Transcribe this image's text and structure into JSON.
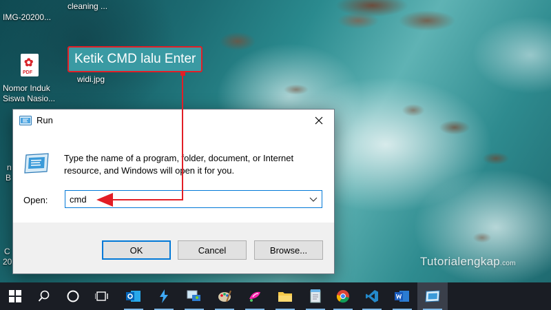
{
  "desktop": {
    "icons": [
      {
        "label": "IMG-20200..."
      },
      {
        "label": "cleaning ..."
      },
      {
        "label": "Nomor Induk Siswa Nasio..."
      },
      {
        "label": "widi.jpg"
      },
      {
        "label": "n"
      },
      {
        "label": "B"
      },
      {
        "label": "C"
      },
      {
        "label": "20"
      }
    ],
    "pdf_badge": "PDF"
  },
  "annotation": {
    "callout_text": "Ketik CMD lalu Enter",
    "color": "#e21e26"
  },
  "run_dialog": {
    "title": "Run",
    "description": "Type the name of a program, folder, document, or Internet resource, and Windows will open it for you.",
    "open_label": "Open:",
    "open_value": "cmd",
    "buttons": {
      "ok": "OK",
      "cancel": "Cancel",
      "browse": "Browse..."
    }
  },
  "watermark": {
    "text": "Tutorialengkap",
    "suffix": ".com"
  },
  "taskbar": {
    "items": [
      "start-icon",
      "search-icon",
      "cortana-icon",
      "task-view-icon",
      "outlook-icon",
      "azure-data-studio-icon",
      "remote-desktop-icon",
      "paint-icon",
      "paint-3d-icon",
      "file-explorer-icon",
      "notepad-icon",
      "chrome-icon",
      "vscode-icon",
      "word-icon",
      "run-app-icon"
    ],
    "accent": "#7fb8e6"
  }
}
